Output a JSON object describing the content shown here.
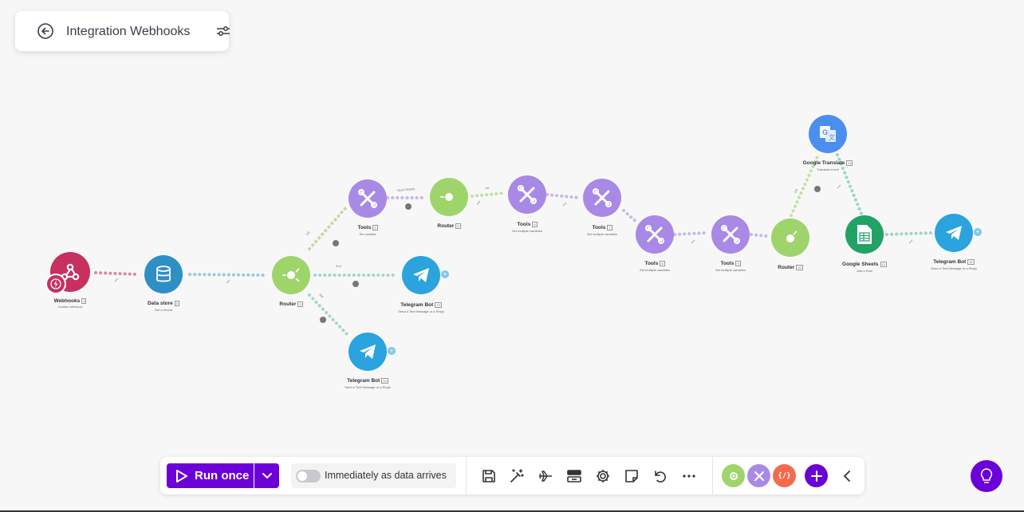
{
  "header": {
    "title": "Integration Webhooks"
  },
  "modules": {
    "webhooks": {
      "name": "Webhooks",
      "sub": "Custom webhook",
      "badge": "1"
    },
    "datastore": {
      "name": "Data store",
      "sub": "Get a record",
      "badge": "2"
    },
    "router1": {
      "name": "Router",
      "badge": "3"
    },
    "tools1": {
      "name": "Tools",
      "sub": "Set variable",
      "badge": "4"
    },
    "router2": {
      "name": "Router",
      "badge": "5"
    },
    "tools2": {
      "name": "Tools",
      "sub": "Set multiple variables",
      "badge": "6"
    },
    "tools3": {
      "name": "Tools",
      "sub": "Set multiple variables",
      "badge": "7"
    },
    "tools4": {
      "name": "Tools",
      "sub": "Set multiple variables",
      "badge": "8"
    },
    "tools5": {
      "name": "Tools",
      "sub": "Set multiple variables",
      "badge": "9"
    },
    "router3": {
      "name": "Router",
      "badge": "10"
    },
    "gtranslate": {
      "name": "Google Translate",
      "sub": "Translate a text",
      "badge": "11"
    },
    "gsheets": {
      "name": "Google Sheets",
      "sub": "Add a Row",
      "badge": "12"
    },
    "telegram1": {
      "name": "Telegram Bot",
      "sub": "Send a Text Message or a Reply",
      "badge": "13"
    },
    "telegram2": {
      "name": "Telegram Bot",
      "sub": "Send a Text Message or a Reply",
      "badge": "14"
    },
    "telegram3": {
      "name": "Telegram Bot",
      "sub": "Send a Text Message or a Reply",
      "badge": "15"
    }
  },
  "route_labels": {
    "r1": "1st",
    "r2": "2nd",
    "r3": "3rd",
    "r4": "Open tickets",
    "r5": "1st",
    "r6": "1st"
  },
  "toolbar": {
    "run_label": "Run once",
    "toggle_label": "Immediately as data arrives",
    "toggle_on": false,
    "icons": [
      "save-icon",
      "magic-wand-icon",
      "airplane-icon",
      "flow-icon",
      "gear-icon",
      "note-icon",
      "undo-icon",
      "more-icon"
    ],
    "mini_apps": [
      "tools-app-green",
      "tools-app-purple",
      "json-app-orange"
    ]
  },
  "colors": {
    "brand": "#6b00d7",
    "webhooks": "#c7305f",
    "datastore": "#2f8fc5",
    "router": "#9fd46b",
    "tools": "#a989e6",
    "telegram": "#2aa3de",
    "gsheets": "#21a366",
    "gtranslate": "#4a8ef0"
  }
}
